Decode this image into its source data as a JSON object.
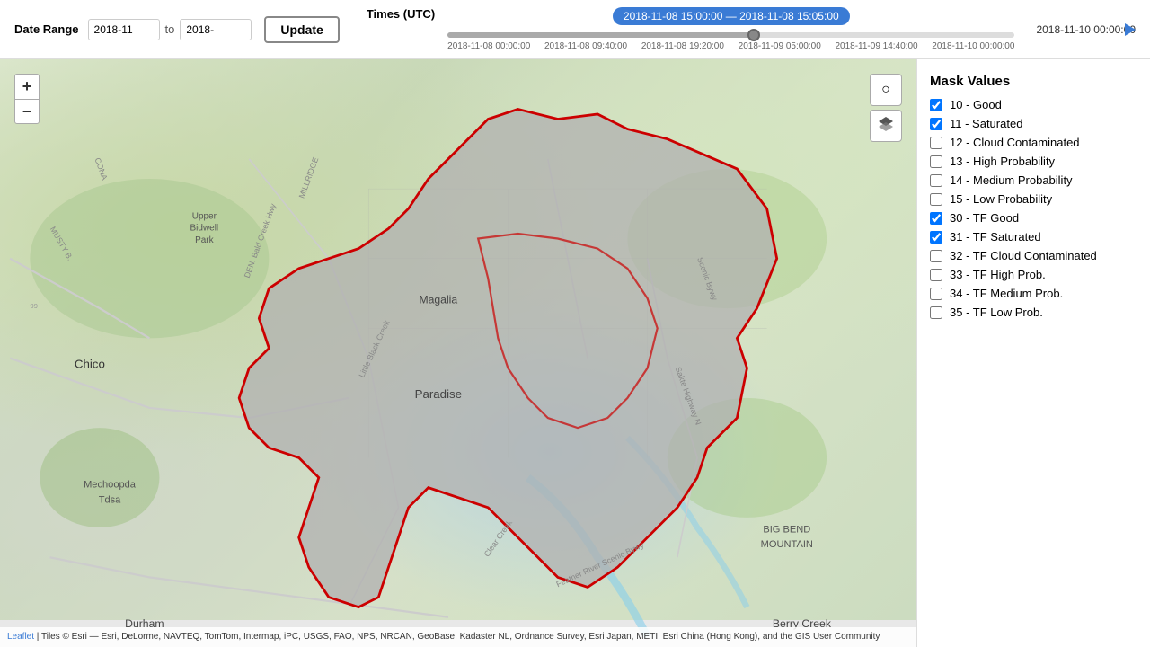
{
  "toolbar": {
    "date_range_label": "Date Range",
    "date_from": "2018-11",
    "date_to_separator": "to",
    "date_to": "2018-",
    "update_label": "Update",
    "times_label": "Times (UTC)",
    "time_range": "2018-11-08 15:00:00 — 2018-11-08 15:05:00",
    "end_time": "2018-11-10 00:00:00",
    "ticks": [
      "2018-11-08 00:00:00",
      "2018-11-08 09:40:00",
      "2018-11-08 19:20:00",
      "2018-11-09 05:00:00",
      "2018-11-09 14:40:00",
      "2018-11-10 00:00:00"
    ]
  },
  "sidebar": {
    "title": "Mask Values",
    "items": [
      {
        "id": "10",
        "label": "10 - Good",
        "checked": true
      },
      {
        "id": "11",
        "label": "11 - Saturated",
        "checked": true
      },
      {
        "id": "12",
        "label": "12 - Cloud Contaminated",
        "checked": false
      },
      {
        "id": "13",
        "label": "13 - High Probability",
        "checked": false
      },
      {
        "id": "14",
        "label": "14 - Medium Probability",
        "checked": false
      },
      {
        "id": "15",
        "label": "15 - Low Probability",
        "checked": false
      },
      {
        "id": "30",
        "label": "30 - TF Good",
        "checked": true
      },
      {
        "id": "31",
        "label": "31 - TF Saturated",
        "checked": true
      },
      {
        "id": "32",
        "label": "32 - TF Cloud Contaminated",
        "checked": false
      },
      {
        "id": "33",
        "label": "33 - TF High Prob.",
        "checked": false
      },
      {
        "id": "34",
        "label": "34 - TF Medium Prob.",
        "checked": false
      },
      {
        "id": "35",
        "label": "35 - TF Low Prob.",
        "checked": false
      }
    ]
  },
  "map": {
    "attribution_leaflet": "Leaflet",
    "attribution_text": " | Tiles © Esri — Esri, DeLorme, NAVTEQ, TomTom, Intermap, iPC, USGS, FAO, NPS, NRCAN, GeoBase, Kadaster NL, Ordnance Survey, Esri Japan, METI, Esri China (Hong Kong), and the GIS User Community"
  },
  "zoom": {
    "plus": "+",
    "minus": "−"
  },
  "icons": {
    "search": "○",
    "layers": "⧉"
  }
}
